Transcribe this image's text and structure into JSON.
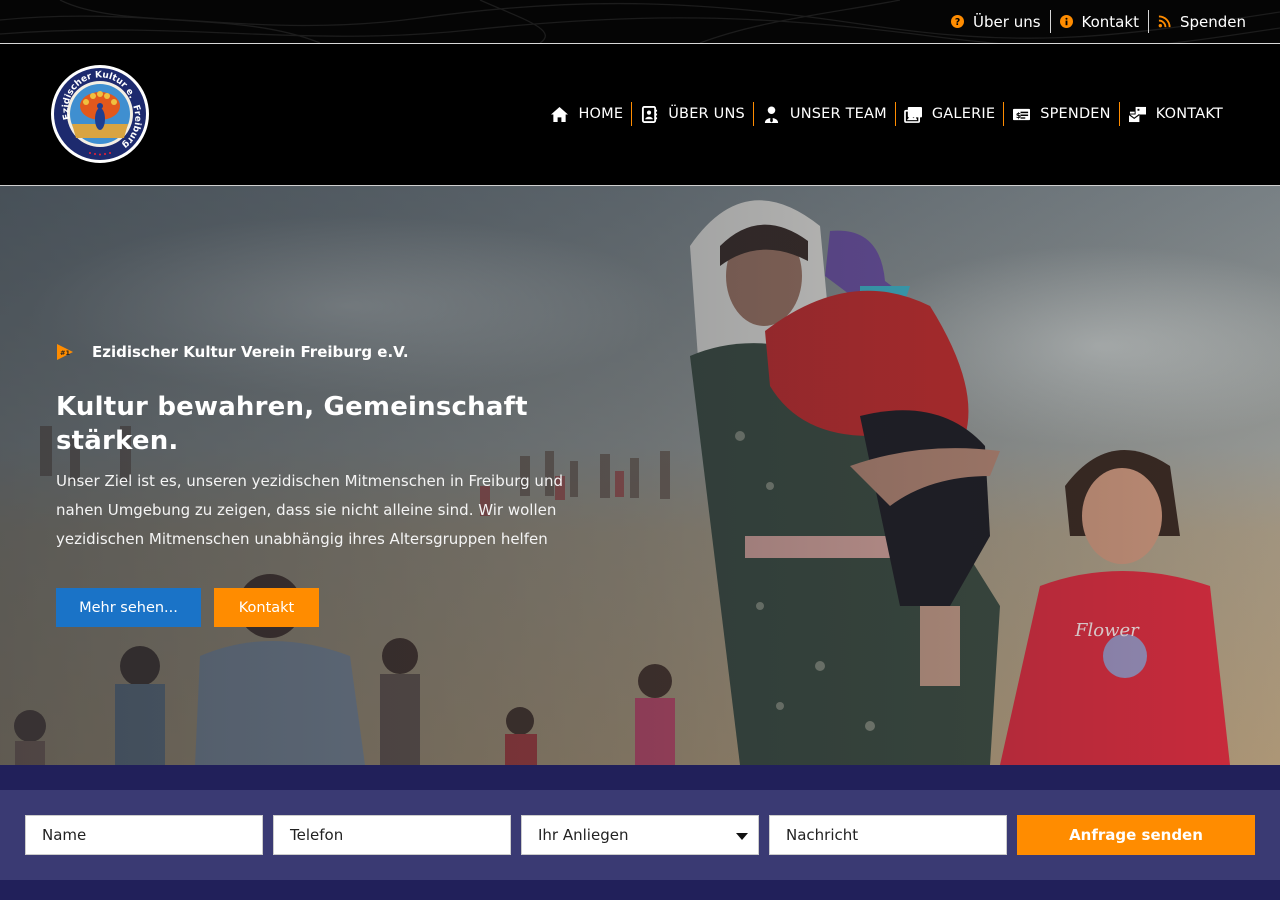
{
  "topbar": {
    "links": [
      {
        "label": "Über uns",
        "icon": "question-circle-icon"
      },
      {
        "label": "Kontakt",
        "icon": "info-circle-icon"
      },
      {
        "label": "Spenden",
        "icon": "rss-icon"
      }
    ]
  },
  "logo": {
    "text_top": "Ezidischer Kultur e.V.",
    "text_right": "Freiburg"
  },
  "nav": {
    "items": [
      {
        "label": "HOME",
        "icon": "home-icon"
      },
      {
        "label": "ÜBER UNS",
        "icon": "contact-book-icon"
      },
      {
        "label": "UNSER TEAM",
        "icon": "user-tie-icon"
      },
      {
        "label": "GALERIE",
        "icon": "images-icon"
      },
      {
        "label": "SPENDEN",
        "icon": "money-check-icon"
      },
      {
        "label": "KONTAKT",
        "icon": "mail-bulk-icon"
      }
    ]
  },
  "hero": {
    "tag": "Ezidischer Kultur Verein Freiburg e.V.",
    "tag_icon_text": "#1",
    "headline": "Kultur bewahren, Gemeinschaft stärken.",
    "description": "Unser Ziel ist es, unseren yezidischen Mitmenschen in Freiburg und nahen Umgebung zu zeigen, dass sie nicht alleine sind. Wir wollen yezidischen Mitmenschen unabhängig ihres Altersgruppen helfen",
    "btn_more": "Mehr sehen...",
    "btn_contact": "Kontakt"
  },
  "form": {
    "name_placeholder": "Name",
    "phone_placeholder": "Telefon",
    "concern_selected": "Ihr Anliegen",
    "message_placeholder": "Nachricht",
    "submit_label": "Anfrage senden"
  },
  "colors": {
    "accent": "#ff8c00",
    "blue": "#1a73c7",
    "band": "#21205a",
    "panel": "#3a3a73"
  }
}
